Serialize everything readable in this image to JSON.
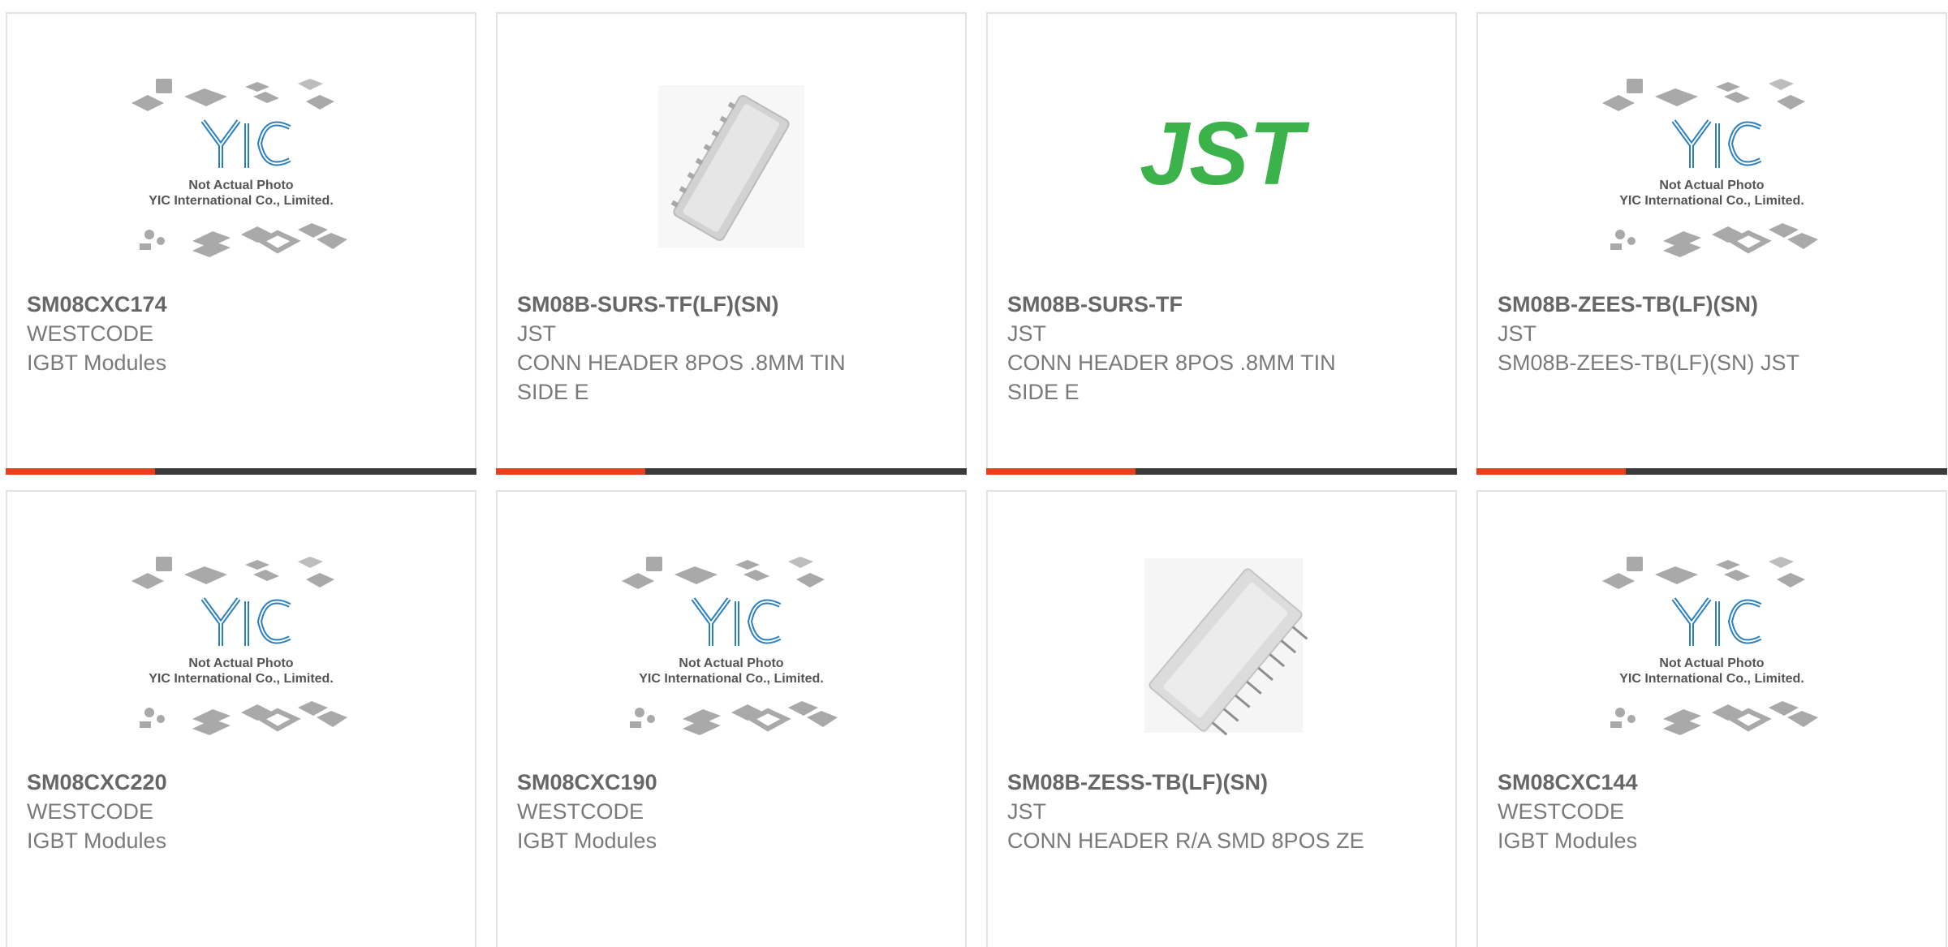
{
  "placeholder_caption": {
    "line1": "Not Actual Photo",
    "line2": "YIC International Co., Limited."
  },
  "products": [
    {
      "part": "SM08CXC174",
      "maker": "WESTCODE",
      "desc": "IGBT Modules",
      "image": "yic-placeholder"
    },
    {
      "part": "SM08B-SURS-TF(LF)(SN)",
      "maker": "JST",
      "desc": "CONN HEADER 8POS .8MM TIN SIDE E",
      "image": "connector-vertical"
    },
    {
      "part": "SM08B-SURS-TF",
      "maker": "JST",
      "desc": "CONN HEADER 8POS .8MM TIN SIDE E",
      "image": "jst-logo",
      "logo_text": "JST"
    },
    {
      "part": "SM08B-ZEES-TB(LF)(SN)",
      "maker": "JST",
      "desc": "SM08B-ZEES-TB(LF)(SN) JST",
      "image": "yic-placeholder"
    },
    {
      "part": "SM08CXC220",
      "maker": "WESTCODE",
      "desc": "IGBT Modules",
      "image": "yic-placeholder"
    },
    {
      "part": "SM08CXC190",
      "maker": "WESTCODE",
      "desc": "IGBT Modules",
      "image": "yic-placeholder"
    },
    {
      "part": "SM08B-ZESS-TB(LF)(SN)",
      "maker": "JST",
      "desc": "CONN HEADER R/A SMD 8POS ZE",
      "image": "connector-right-angle"
    },
    {
      "part": "SM08CXC144",
      "maker": "WESTCODE",
      "desc": "IGBT Modules",
      "image": "yic-placeholder"
    }
  ],
  "colors": {
    "accent": "#e8401c",
    "bar": "#3a3a3a",
    "yic_blue": "#2a7fc1",
    "jst_green": "#3bb24a"
  }
}
